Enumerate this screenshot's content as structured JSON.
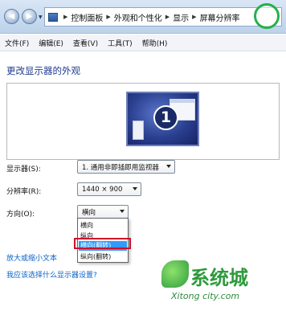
{
  "address_bar": {
    "breadcrumbs": [
      "控制面板",
      "外观和个性化",
      "显示",
      "屏幕分辨率"
    ]
  },
  "menubar": {
    "items": [
      "文件(F)",
      "编辑(E)",
      "查看(V)",
      "工具(T)",
      "帮助(H)"
    ]
  },
  "main": {
    "title": "更改显示器的外观",
    "monitor_number": "1",
    "display": {
      "label": "显示器(S):",
      "value": "1. 通用非即插即用监视器"
    },
    "resolution": {
      "label": "分辨率(R):",
      "value": "1440 × 900"
    },
    "orientation": {
      "label": "方向(O):",
      "value": "横向",
      "options": [
        "横向",
        "纵向",
        "横向(翻转)",
        "纵向(翻转)"
      ],
      "highlighted": "横向(翻转)"
    },
    "links": {
      "text_size": "放大或缩小文本",
      "which_settings": "我应该选择什么显示器设置?"
    }
  },
  "watermark": {
    "brand": "系统城",
    "url": "Xitong city.com"
  },
  "colors": {
    "title_blue": "#1f3b8f",
    "link_blue": "#0b63c6",
    "highlight": "#3399ff",
    "annotation_red": "#d0102b"
  }
}
